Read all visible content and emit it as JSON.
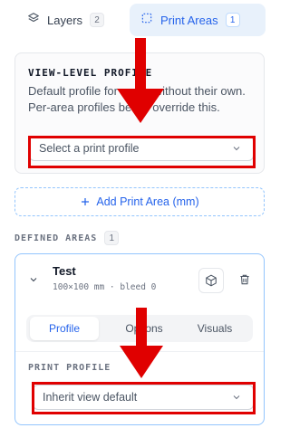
{
  "tabs": {
    "layers": {
      "label": "Layers",
      "count": "2"
    },
    "print_areas": {
      "label": "Print Areas",
      "count": "1"
    }
  },
  "view_level": {
    "title": "VIEW-LEVEL PROFILE",
    "description": "Default profile for areas without their own. Per-area profiles below override this.",
    "select_placeholder": "Select a print profile"
  },
  "add_area_label": "Add Print Area (mm)",
  "defined_areas": {
    "title": "DEFINED AREAS",
    "count": "1"
  },
  "area": {
    "name": "Test",
    "meta": "100×100 mm · bleed 0",
    "tabs": [
      "Profile",
      "Options",
      "Visuals"
    ],
    "print_profile_title": "PRINT PROFILE",
    "profile_value": "Inherit view default"
  },
  "colors": {
    "accent": "#2563eb",
    "annotation_red": "#e00000"
  },
  "icons": [
    "layers-icon",
    "dashed-square-icon",
    "chevron-down-icon",
    "plus-icon",
    "cube-icon",
    "trash-icon"
  ]
}
